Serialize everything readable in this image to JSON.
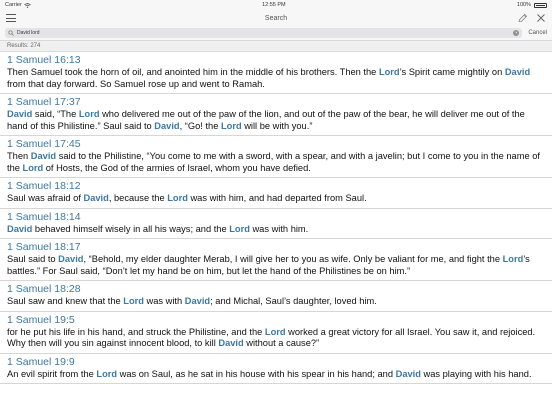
{
  "status": {
    "carrier": "Carrier",
    "time": "12:55 PM",
    "battery": "100%"
  },
  "nav": {
    "title": "Search"
  },
  "search": {
    "query": "David lord",
    "cancel_label": "Cancel"
  },
  "results": {
    "count_label": "Results: 274"
  },
  "highlight_color": "#3d78a4",
  "verses": [
    {
      "ref": "1 Samuel 16:13",
      "parts": [
        {
          "t": "Then Samuel took the horn of oil, and anointed him in the middle of his brothers. Then the "
        },
        {
          "t": "Lord",
          "h": true
        },
        {
          "t": "’s Spirit came mightily on "
        },
        {
          "t": "David",
          "h": true
        },
        {
          "t": " from that day forward. So Samuel rose up and went to Ramah."
        }
      ]
    },
    {
      "ref": "1 Samuel 17:37",
      "parts": [
        {
          "t": "David",
          "h": true
        },
        {
          "t": " said, “The "
        },
        {
          "t": "Lord",
          "h": true
        },
        {
          "t": " who delivered me out of the paw of the lion, and out of the paw of the bear, he will deliver me out of the hand of this Philistine.” Saul said to "
        },
        {
          "t": "David",
          "h": true
        },
        {
          "t": ", “Go! the "
        },
        {
          "t": "Lord",
          "h": true
        },
        {
          "t": " will be with you.”"
        }
      ]
    },
    {
      "ref": "1 Samuel 17:45",
      "parts": [
        {
          "t": "Then "
        },
        {
          "t": "David",
          "h": true
        },
        {
          "t": " said to the Philistine, “You come to me with a sword, with a spear, and with a javelin; but I come to you in the name of the "
        },
        {
          "t": "Lord",
          "h": true
        },
        {
          "t": " of Hosts, the God of the armies of Israel, whom you have defied."
        }
      ]
    },
    {
      "ref": "1 Samuel 18:12",
      "parts": [
        {
          "t": "Saul was afraid of "
        },
        {
          "t": "David",
          "h": true
        },
        {
          "t": ", because the "
        },
        {
          "t": "Lord",
          "h": true
        },
        {
          "t": " was with him, and had departed from Saul."
        }
      ]
    },
    {
      "ref": "1 Samuel 18:14",
      "parts": [
        {
          "t": "David",
          "h": true
        },
        {
          "t": " behaved himself wisely in all his ways; and the "
        },
        {
          "t": "Lord",
          "h": true
        },
        {
          "t": " was with him."
        }
      ]
    },
    {
      "ref": "1 Samuel 18:17",
      "parts": [
        {
          "t": "Saul said to "
        },
        {
          "t": "David",
          "h": true
        },
        {
          "t": ", “Behold, my elder daughter Merab, I will give her to you as wife. Only be valiant for me, and fight the "
        },
        {
          "t": "Lord",
          "h": true
        },
        {
          "t": "’s battles.” For Saul said, “Don’t let my hand be on him, but let the hand of the Philistines be on him.”"
        }
      ]
    },
    {
      "ref": "1 Samuel 18:28",
      "parts": [
        {
          "t": "Saul saw and knew that the "
        },
        {
          "t": "Lord",
          "h": true
        },
        {
          "t": " was with "
        },
        {
          "t": "David",
          "h": true
        },
        {
          "t": "; and Michal, Saul’s daughter, loved him."
        }
      ]
    },
    {
      "ref": "1 Samuel 19:5",
      "parts": [
        {
          "t": "for he put his life in his hand, and struck the Philistine, and the "
        },
        {
          "t": "Lord",
          "h": true
        },
        {
          "t": " worked a great victory for all Israel. You saw it, and rejoiced. Why then will you sin against innocent blood, to kill "
        },
        {
          "t": "David",
          "h": true
        },
        {
          "t": " without a cause?”"
        }
      ]
    },
    {
      "ref": "1 Samuel 19:9",
      "parts": [
        {
          "t": "An evil spirit from the "
        },
        {
          "t": "Lord",
          "h": true
        },
        {
          "t": " was on Saul, as he sat in his house with his spear in his hand; and "
        },
        {
          "t": "David",
          "h": true
        },
        {
          "t": " was playing with his hand."
        }
      ]
    }
  ]
}
